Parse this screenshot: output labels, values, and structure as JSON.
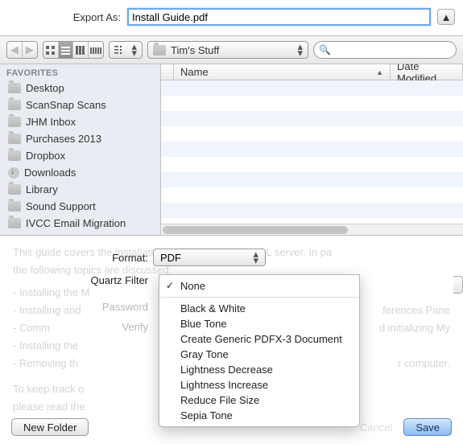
{
  "export": {
    "label": "Export As:",
    "filename": "Install Guide.pdf"
  },
  "toolbar": {
    "folder_label": "Tim's Stuff",
    "search_placeholder": ""
  },
  "sidebar": {
    "header": "FAVORITES",
    "items": [
      {
        "label": "Desktop",
        "icon": "folder"
      },
      {
        "label": "ScanSnap Scans",
        "icon": "folder"
      },
      {
        "label": "JHM Inbox",
        "icon": "folder"
      },
      {
        "label": "Purchases 2013",
        "icon": "folder"
      },
      {
        "label": "Dropbox",
        "icon": "folder"
      },
      {
        "label": "Downloads",
        "icon": "down"
      },
      {
        "label": "Library",
        "icon": "folder"
      },
      {
        "label": "Sound Support",
        "icon": "folder"
      },
      {
        "label": "IVCC Email Migration",
        "icon": "folder"
      }
    ]
  },
  "columns": {
    "name": "Name",
    "date": "Date Modified"
  },
  "options": {
    "format_label": "Format:",
    "format_value": "PDF",
    "quartz_label": "Quartz Filter",
    "password_label": "Password",
    "verify_label": "Verify"
  },
  "quartz_menu": {
    "selected": "None",
    "items": [
      "None",
      "Black & White",
      "Blue Tone",
      "Create Generic PDFX-3 Document",
      "Gray Tone",
      "Lightness Decrease",
      "Lightness Increase",
      "Reduce File Size",
      "Sepia Tone"
    ]
  },
  "buttons": {
    "new_folder": "New Folder",
    "cancel": "Cancel",
    "save": "Save"
  },
  "ghost_text": {
    "l1": "This guide covers the installation and setup of a MySQL server. In pa",
    "l2": "the following topics are discussed:",
    "l3": "- Installing the M",
    "l4": "- Installing and",
    "l5": "- Comm",
    "l6": "- Installing the",
    "l7": "- Removing th",
    "l8": "To keep track o",
    "l9": "please read the",
    "r4": "ferences Pane",
    "r5": "d initializing My",
    "r7": "r computer."
  }
}
